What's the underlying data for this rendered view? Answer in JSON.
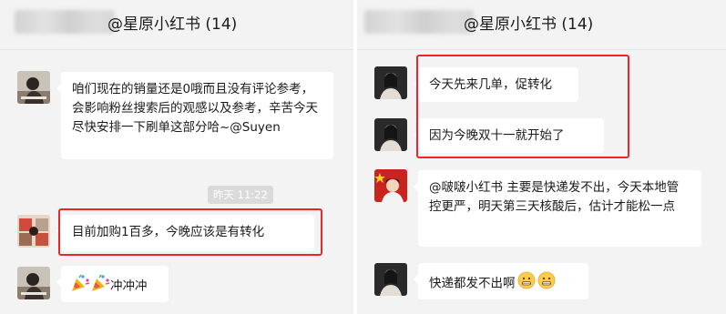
{
  "left_chat": {
    "title": "@星原小红书 (14)",
    "messages": [
      {
        "text": "咱们现在的销量还是0哦而且没有评论参考，会影响粉丝搜索后的观感以及参考，辛苦今天尽快安排一下刷单这部分哈~@Suyen"
      },
      {
        "text": "目前加购1百多，今晚应该是有转化"
      },
      {
        "text": "冲冲冲",
        "emoji": [
          "party-popper",
          "party-popper"
        ]
      }
    ],
    "timestamp": "昨天 11:22"
  },
  "right_chat": {
    "title": "@星原小红书 (14)",
    "messages": [
      {
        "text": "今天先来几单，促转化"
      },
      {
        "text": "因为今晚双十一就开始了"
      },
      {
        "text": "@啵啵小红书 主要是快递发不出，今天本地管控更严，明天第三天核酸后，估计才能松一点"
      },
      {
        "text": "快递都发不出啊",
        "emoji": [
          "grimacing-face",
          "grimacing-face"
        ]
      }
    ]
  },
  "colors": {
    "highlight": "#e8262b",
    "bubble": "#ffffff",
    "background": "#f3f3f3",
    "timestamp_bg": "#dadada"
  }
}
